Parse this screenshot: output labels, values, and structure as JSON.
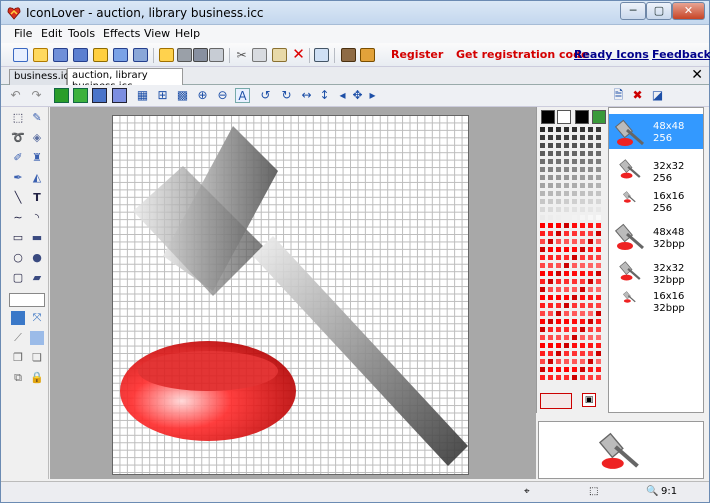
{
  "window": {
    "title": "IconLover - auction, library business.icc",
    "min_label": "─",
    "max_label": "▢",
    "close_label": "✕"
  },
  "menu": [
    "File",
    "Edit",
    "Tools",
    "Effects",
    "View",
    "Help"
  ],
  "toolbar": {
    "register": "Register",
    "get_code": "Get registration code",
    "ready_icons": "Ready Icons",
    "feedback": "Feedback",
    "icons": [
      "new-icon",
      "open-icon",
      "save-icon",
      "save-as-icon",
      "export-icon",
      "import-icon",
      "library-icon",
      "folder-icon",
      "print-icon",
      "print-preview-icon",
      "cut-icon",
      "copy-icon",
      "paste-icon",
      "delete-icon",
      "properties-icon",
      "library-manager-icon",
      "help-icon"
    ]
  },
  "tabs": [
    "business.icc",
    "auction, library business.icc"
  ],
  "tab_close": "✕",
  "images": [
    {
      "l1": "48x48",
      "l2": "256"
    },
    {
      "l1": "32x32",
      "l2": "256"
    },
    {
      "l1": "16x16",
      "l2": "256"
    },
    {
      "l1": "48x48",
      "l2": "32bpp"
    },
    {
      "l1": "32x32",
      "l2": "32bpp"
    },
    {
      "l1": "16x16",
      "l2": "32bpp"
    }
  ],
  "status": {
    "zoom": "9:1"
  },
  "colors": {
    "accent": "#3399ff",
    "link_red": "#d40000",
    "link_blue": "#00008b",
    "canvas_bg": "#a8a8a8"
  }
}
